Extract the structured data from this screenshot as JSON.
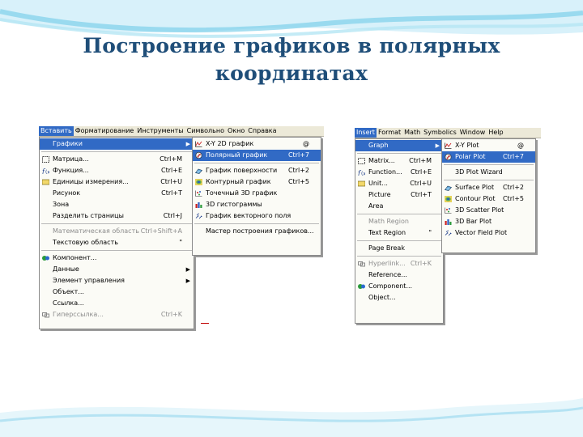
{
  "slide": {
    "title": "Построение графиков в полярных координатах"
  },
  "left_screenshot": {
    "menubar": [
      "Вставить",
      "Форматирование",
      "Инструменты",
      "Символьно",
      "Окно",
      "Справка"
    ],
    "insert_menu": [
      {
        "label": "Графики",
        "shortcut": "",
        "submenu": true,
        "selected": true,
        "icon": ""
      },
      {
        "sep": true
      },
      {
        "label": "Матрица...",
        "shortcut": "Ctrl+M",
        "icon": "matrix-icon"
      },
      {
        "label": "Функция...",
        "shortcut": "Ctrl+E",
        "icon": "function-icon"
      },
      {
        "label": "Единицы измерения...",
        "shortcut": "Ctrl+U",
        "icon": "units-icon"
      },
      {
        "label": "Рисунок",
        "shortcut": "Ctrl+T",
        "icon": ""
      },
      {
        "label": "Зона",
        "shortcut": "",
        "icon": ""
      },
      {
        "label": "Разделить страницы",
        "shortcut": "Ctrl+J",
        "icon": ""
      },
      {
        "sep": true
      },
      {
        "label": "Математическая область",
        "shortcut": "Ctrl+Shift+A",
        "disabled": true,
        "icon": ""
      },
      {
        "label": "Текстовую область",
        "shortcut": "\"",
        "icon": ""
      },
      {
        "sep": true
      },
      {
        "label": "Компонент...",
        "shortcut": "",
        "icon": "component-icon"
      },
      {
        "label": "Данные",
        "shortcut": "",
        "submenu": true,
        "icon": ""
      },
      {
        "label": "Элемент управления",
        "shortcut": "",
        "submenu": true,
        "icon": ""
      },
      {
        "label": "Объект...",
        "shortcut": "",
        "icon": ""
      },
      {
        "label": "Ссылка...",
        "shortcut": "",
        "icon": ""
      },
      {
        "label": "Гиперссылка...",
        "shortcut": "Ctrl+K",
        "disabled": true,
        "icon": "hyperlink-icon"
      }
    ],
    "graph_submenu": [
      {
        "label": "X-Y 2D график",
        "shortcut": "@",
        "icon": "xy-plot-icon"
      },
      {
        "label": "Полярный график",
        "shortcut": "Ctrl+7",
        "selected": true,
        "icon": "polar-plot-icon"
      },
      {
        "sep": true
      },
      {
        "label": "График поверхности",
        "shortcut": "Ctrl+2",
        "icon": "surface-plot-icon"
      },
      {
        "label": "Контурный график",
        "shortcut": "Ctrl+5",
        "icon": "contour-plot-icon"
      },
      {
        "label": "Точечный 3D график",
        "shortcut": "",
        "icon": "scatter3d-icon"
      },
      {
        "label": "3D гистограммы",
        "shortcut": "",
        "icon": "bar3d-icon"
      },
      {
        "label": "График векторного поля",
        "shortcut": "",
        "icon": "vector-field-icon"
      },
      {
        "sep": true
      },
      {
        "label": "Мастер построения графиков...",
        "shortcut": "",
        "icon": ""
      }
    ]
  },
  "right_screenshot": {
    "menubar": [
      "Insert",
      "Format",
      "Math",
      "Symbolics",
      "Window",
      "Help"
    ],
    "insert_menu": [
      {
        "label": "Graph",
        "shortcut": "",
        "submenu": true,
        "selected": true,
        "icon": ""
      },
      {
        "sep": true
      },
      {
        "label": "Matrix...",
        "shortcut": "Ctrl+M",
        "icon": "matrix-icon"
      },
      {
        "label": "Function...",
        "shortcut": "Ctrl+E",
        "icon": "function-icon"
      },
      {
        "label": "Unit...",
        "shortcut": "Ctrl+U",
        "icon": "units-icon"
      },
      {
        "label": "Picture",
        "shortcut": "Ctrl+T",
        "icon": ""
      },
      {
        "label": "Area",
        "shortcut": "",
        "icon": ""
      },
      {
        "sep": true
      },
      {
        "label": "Math Region",
        "shortcut": "",
        "disabled": true,
        "icon": ""
      },
      {
        "label": "Text Region",
        "shortcut": "\"",
        "icon": ""
      },
      {
        "sep": true
      },
      {
        "label": "Page Break",
        "shortcut": "",
        "icon": ""
      },
      {
        "sep": true
      },
      {
        "label": "Hyperlink...",
        "shortcut": "Ctrl+K",
        "disabled": true,
        "icon": "hyperlink-icon"
      },
      {
        "label": "Reference...",
        "shortcut": "",
        "icon": ""
      },
      {
        "label": "Component...",
        "shortcut": "",
        "icon": "component-icon"
      },
      {
        "label": "Object...",
        "shortcut": "",
        "icon": ""
      }
    ],
    "graph_submenu": [
      {
        "label": "X-Y Plot",
        "shortcut": "@",
        "icon": "xy-plot-icon"
      },
      {
        "label": "Polar Plot",
        "shortcut": "Ctrl+7",
        "selected": true,
        "icon": "polar-plot-icon"
      },
      {
        "sep": true
      },
      {
        "label": "3D Plot Wizard",
        "shortcut": "",
        "icon": ""
      },
      {
        "sep": true
      },
      {
        "label": "Surface Plot",
        "shortcut": "Ctrl+2",
        "icon": "surface-plot-icon"
      },
      {
        "label": "Contour Plot",
        "shortcut": "Ctrl+5",
        "icon": "contour-plot-icon"
      },
      {
        "label": "3D Scatter Plot",
        "shortcut": "",
        "icon": "scatter3d-icon"
      },
      {
        "label": "3D Bar Plot",
        "shortcut": "",
        "icon": "bar3d-icon"
      },
      {
        "label": "Vector Field Plot",
        "shortcut": "",
        "icon": "vector-field-icon"
      }
    ]
  },
  "colors": {
    "title": "#1f4e79",
    "menu_highlight": "#316ac5",
    "menubar_bg": "#ece9d8",
    "wave": "#7fd0ea"
  }
}
